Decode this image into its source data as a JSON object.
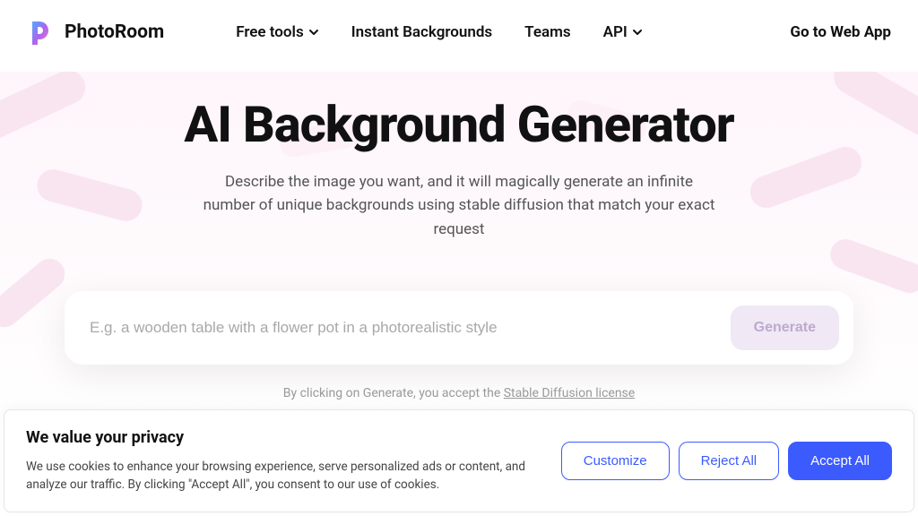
{
  "header": {
    "logo_text": "PhotoRoom",
    "nav": {
      "free_tools": "Free tools",
      "instant_backgrounds": "Instant Backgrounds",
      "teams": "Teams",
      "api": "API"
    },
    "go_webapp": "Go to Web App"
  },
  "hero": {
    "title": "AI Background Generator",
    "description": "Describe the image you want, and it will magically generate an infinite number of unique backgrounds using stable diffusion that match your exact request"
  },
  "prompt": {
    "placeholder": "E.g. a wooden table with a flower pot in a photorealistic style",
    "value": "",
    "generate_label": "Generate"
  },
  "license": {
    "prefix": "By clicking on Generate, you accept the ",
    "link_text": "Stable Diffusion license"
  },
  "cookie": {
    "title": "We value your privacy",
    "description": "We use cookies to enhance your browsing experience, serve personalized ads or content, and analyze our traffic. By clicking \"Accept All\", you consent to our use of cookies.",
    "customize": "Customize",
    "reject": "Reject All",
    "accept": "Accept All"
  },
  "colors": {
    "accent": "#3b5bff",
    "generate_bg": "#f0e8f5"
  }
}
